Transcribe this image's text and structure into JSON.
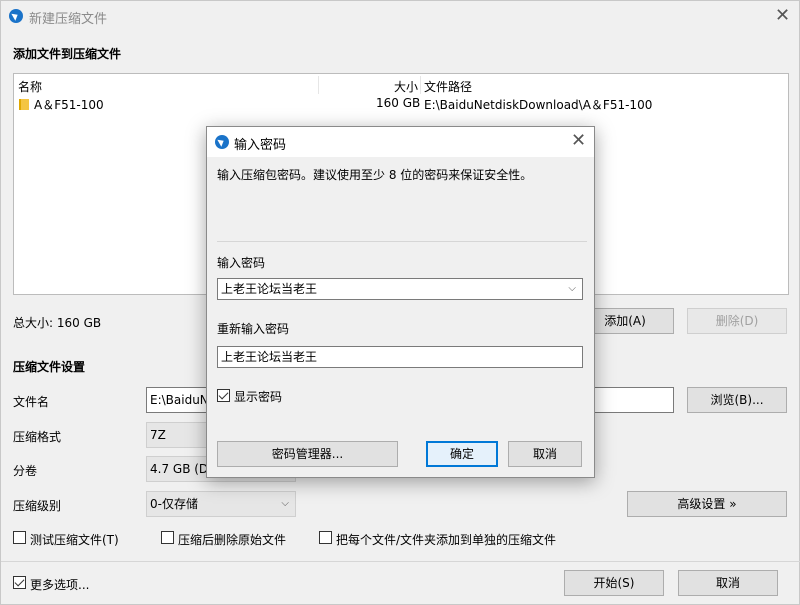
{
  "window": {
    "title": "新建压缩文件",
    "close_symbol": "✕"
  },
  "files_section": {
    "heading": "添加文件到压缩文件",
    "columns": {
      "name": "名称",
      "size": "大小",
      "path": "文件路径"
    },
    "rows": [
      {
        "name": "A＆F51-100",
        "size": "160 GB",
        "path": "E:\\BaiduNetdiskDownload\\A＆F51-100"
      }
    ],
    "total_label": "总大小: 160 GB",
    "add_button": "添加(A)",
    "delete_button": "删除(D)"
  },
  "settings": {
    "heading": "压缩文件设置",
    "filename_label": "文件名",
    "filename_value": "E:\\BaiduN",
    "browse_button": "浏览(B)...",
    "format_label": "压缩格式",
    "format_value": "7Z",
    "volume_label": "分卷",
    "volume_value": "4.7 GB (DV",
    "level_label": "压缩级别",
    "level_value": "0-仅存储",
    "advanced_button": "高级设置 »",
    "test_checkbox": "测试压缩文件(T)",
    "delete_after_checkbox": "压缩后删除原始文件",
    "separate_checkbox": "把每个文件/文件夹添加到单独的压缩文件",
    "more_options_checkbox": "更多选项...",
    "start_button": "开始(S)",
    "cancel_button": "取消"
  },
  "password_dialog": {
    "title": "输入密码",
    "close_symbol": "✕",
    "description": "输入压缩包密码。建议使用至少 8 位的密码来保证安全性。",
    "password_label": "输入密码",
    "password_value": "上老王论坛当老王",
    "confirm_label": "重新输入密码",
    "confirm_value": "上老王论坛当老王",
    "show_password": "显示密码",
    "show_password_checked": true,
    "manager_button": "密码管理器...",
    "ok_button": "确定",
    "cancel_button": "取消"
  },
  "colors": {
    "accent": "#0078d7",
    "brand": "#1a73c9"
  }
}
